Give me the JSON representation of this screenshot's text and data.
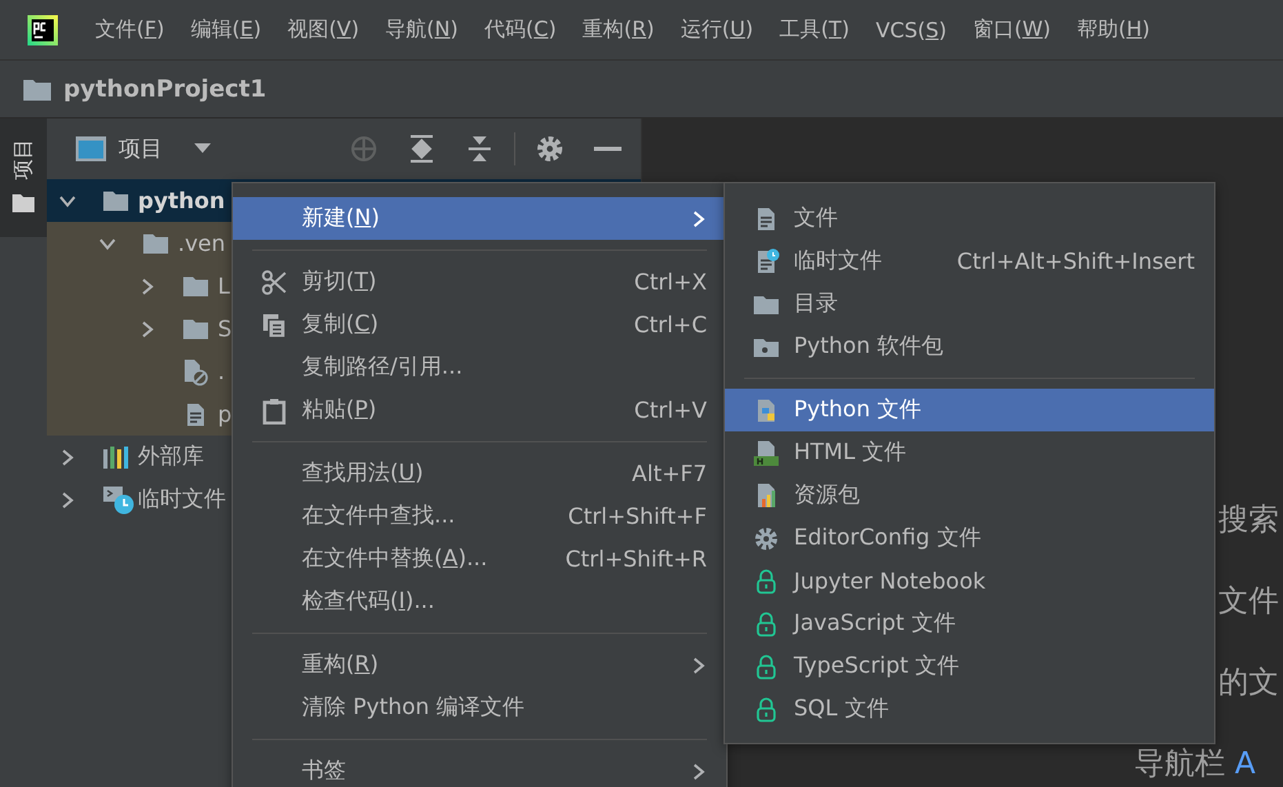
{
  "menu_bar": [
    {
      "label": "文件(",
      "key": "F",
      "tail": ")"
    },
    {
      "label": "编辑(",
      "key": "E",
      "tail": ")"
    },
    {
      "label": "视图(",
      "key": "V",
      "tail": ")"
    },
    {
      "label": "导航(",
      "key": "N",
      "tail": ")"
    },
    {
      "label": "代码(",
      "key": "C",
      "tail": ")"
    },
    {
      "label": "重构(",
      "key": "R",
      "tail": ")"
    },
    {
      "label": "运行(",
      "key": "U",
      "tail": ")"
    },
    {
      "label": "工具(",
      "key": "T",
      "tail": ")"
    },
    {
      "label": "VCS(",
      "key": "S",
      "tail": ")"
    },
    {
      "label": "窗口(",
      "key": "W",
      "tail": ")"
    },
    {
      "label": "帮助(",
      "key": "H",
      "tail": ")"
    }
  ],
  "navigation_bar": {
    "path": "pythonProject1"
  },
  "side_strip": {
    "tabs": [
      {
        "label": "项目",
        "selected": true
      }
    ]
  },
  "project_panel": {
    "view_selector": "项目",
    "tree": [
      {
        "label": "python",
        "kind": "folder",
        "expanded": true,
        "selected": true,
        "excluded": false,
        "children": [
          {
            "label": ".ven",
            "kind": "folder",
            "expanded": true,
            "selected": false,
            "excluded": true,
            "children": [
              {
                "label": "L",
                "kind": "folder",
                "expanded": false,
                "selected": false,
                "excluded": true
              },
              {
                "label": "S",
                "kind": "folder",
                "expanded": false,
                "selected": false,
                "excluded": true
              },
              {
                "label": ".",
                "kind": "ignored-file",
                "selected": false,
                "excluded": true
              },
              {
                "label": "p",
                "kind": "text-file",
                "selected": false,
                "excluded": true
              }
            ]
          }
        ]
      },
      {
        "label": "外部库",
        "kind": "library",
        "expanded": false,
        "selected": false,
        "excluded": false
      },
      {
        "label": "临时文件",
        "kind": "scratch",
        "expanded": false,
        "selected": false,
        "excluded": false
      }
    ]
  },
  "editor": {
    "hints": [
      {
        "text": "搜索"
      },
      {
        "text": "文件"
      },
      {
        "text": "的文"
      },
      {
        "text": "导航栏",
        "accent": "A"
      }
    ]
  },
  "context_menu": {
    "items": [
      {
        "kind": "plain",
        "label": "新建(",
        "key": "N",
        "tail": ")",
        "submenu": true,
        "selected": true
      },
      {
        "kind": "separator"
      },
      {
        "kind": "cut",
        "label": "剪切(",
        "key": "T",
        "tail": ")",
        "shortcut": "Ctrl+X",
        "selected": false
      },
      {
        "kind": "copy",
        "label": "复制(",
        "key": "C",
        "tail": ")",
        "shortcut": "Ctrl+C",
        "selected": false
      },
      {
        "kind": "plain",
        "label": "复制路径/引用...",
        "selected": false
      },
      {
        "kind": "paste",
        "label": "粘贴(",
        "key": "P",
        "tail": ")",
        "shortcut": "Ctrl+V",
        "selected": false
      },
      {
        "kind": "separator"
      },
      {
        "kind": "plain",
        "label": "查找用法(",
        "key": "U",
        "tail": ")",
        "shortcut": "Alt+F7",
        "selected": false
      },
      {
        "kind": "plain",
        "label": "在文件中查找...",
        "shortcut": "Ctrl+Shift+F",
        "selected": false
      },
      {
        "kind": "plain",
        "label": "在文件中替换(",
        "key": "A",
        "tail": ")...",
        "shortcut": "Ctrl+Shift+R",
        "selected": false
      },
      {
        "kind": "plain",
        "label": "检查代码(",
        "key": "I",
        "tail": ")...",
        "selected": false
      },
      {
        "kind": "separator"
      },
      {
        "kind": "plain",
        "label": "重构(",
        "key": "R",
        "tail": ")",
        "submenu": true,
        "selected": false
      },
      {
        "kind": "plain",
        "label": "清除 Python 编译文件",
        "selected": false
      },
      {
        "kind": "separator"
      },
      {
        "kind": "plain",
        "label": "书签",
        "submenu": true,
        "selected": false
      }
    ]
  },
  "new_submenu": {
    "items": [
      {
        "kind": "file",
        "label": "文件",
        "selected": false
      },
      {
        "kind": "scratch-file",
        "label": "临时文件",
        "shortcut": "Ctrl+Alt+Shift+Insert",
        "selected": false
      },
      {
        "kind": "directory",
        "label": "目录",
        "selected": false
      },
      {
        "kind": "package",
        "label": "Python 软件包",
        "selected": false
      },
      {
        "kind": "separator"
      },
      {
        "kind": "python-file",
        "label": "Python 文件",
        "selected": true
      },
      {
        "kind": "html-file",
        "label": "HTML 文件",
        "selected": false
      },
      {
        "kind": "resource-bundle",
        "label": "资源包",
        "selected": false
      },
      {
        "kind": "editorconfig",
        "label": "EditorConfig 文件",
        "selected": false
      },
      {
        "kind": "locked",
        "label": "Jupyter Notebook",
        "selected": false
      },
      {
        "kind": "locked",
        "label": "JavaScript 文件",
        "selected": false
      },
      {
        "kind": "locked",
        "label": "TypeScript 文件",
        "selected": false
      },
      {
        "kind": "locked",
        "label": "SQL 文件",
        "selected": false
      }
    ]
  }
}
